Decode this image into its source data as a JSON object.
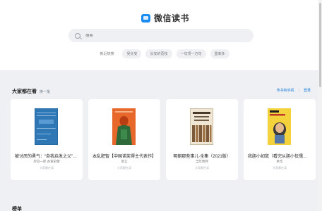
{
  "brand": {
    "name": "微信读书",
    "color": "#1a8bf0"
  },
  "search": {
    "placeholder": "搜索"
  },
  "hot_tags": [
    {
      "label": "新近热搜"
    },
    {
      "label": "吴长安"
    },
    {
      "label": "长安的荔枝"
    },
    {
      "label": "一句顶一万句"
    },
    {
      "label": "墨菲多"
    }
  ],
  "section": {
    "title": "大家都在看",
    "refresh_label": "换一批",
    "phone_link": "传书到手机",
    "login_link": "登录"
  },
  "books": [
    {
      "title": "被讨厌的勇气：“自我启发之父”阿德勒的哲学课",
      "author": "岸见一郎 古贺史健",
      "source": "大家都在读",
      "cover": "blue-hardcover"
    },
    {
      "title": "本乱肥智【中国诺奖得主代表作】",
      "author": "莫言",
      "source": "大家都在读",
      "cover": "orange-figure"
    },
    {
      "title": "明朝那些事儿·全集（2021版）",
      "author": "当年明月",
      "source": "大家都在读",
      "cover": "boxset"
    },
    {
      "title": "我胆小如鼠（看完从胆小怯懦变自信）",
      "author": "余华",
      "source": "大家都在读",
      "cover": "yellow-portrait"
    }
  ],
  "next_section": {
    "title": "榜单"
  }
}
